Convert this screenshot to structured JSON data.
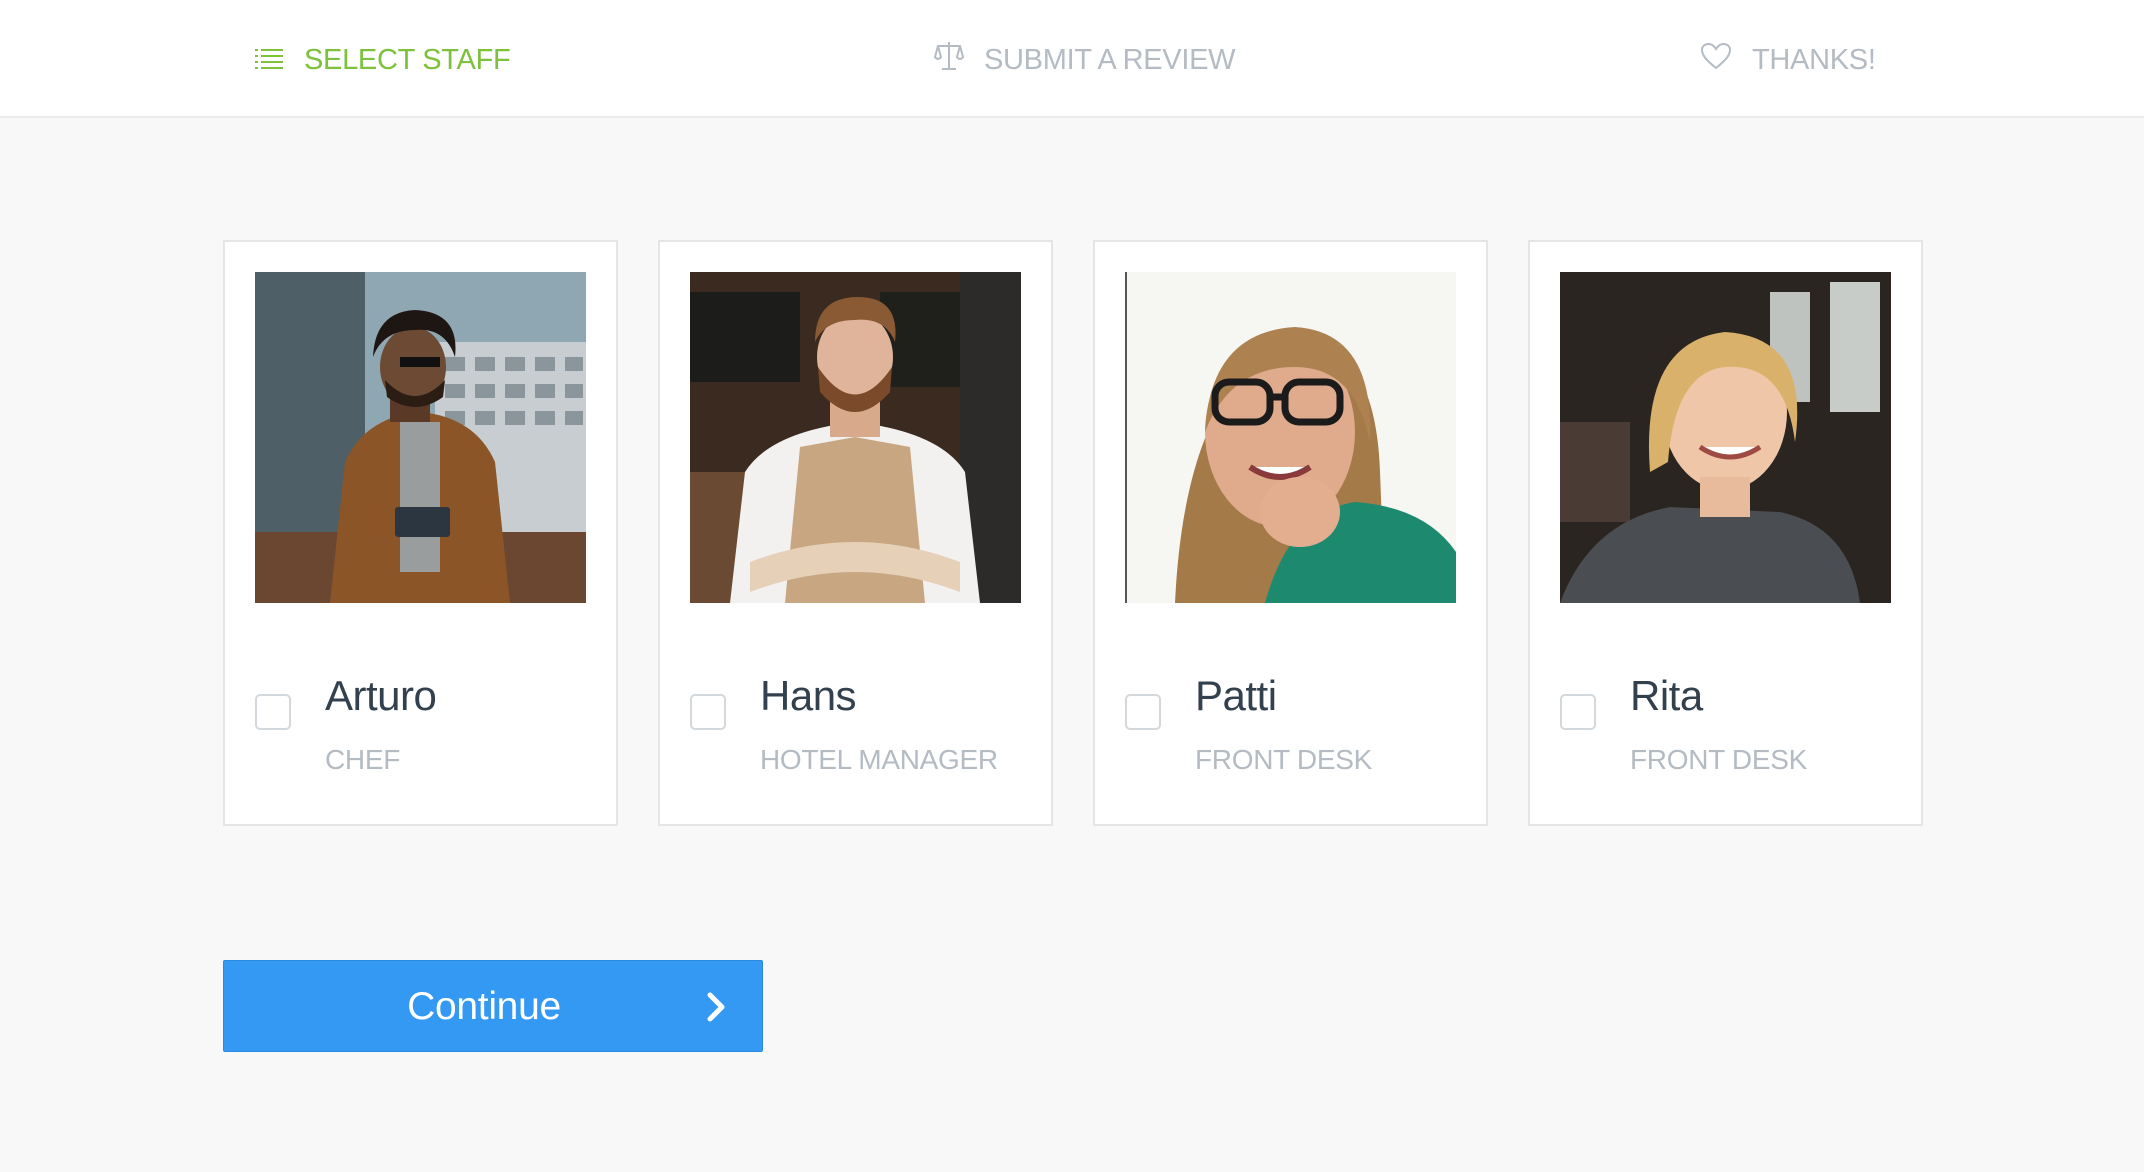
{
  "steps": [
    {
      "label": "SELECT STAFF",
      "icon": "list-icon",
      "active": true
    },
    {
      "label": "SUBMIT A REVIEW",
      "icon": "scales-icon",
      "active": false
    },
    {
      "label": "THANKS!",
      "icon": "heart-icon",
      "active": false
    }
  ],
  "staff": [
    {
      "name": "Arturo",
      "role": "CHEF",
      "checked": false
    },
    {
      "name": "Hans",
      "role": "HOTEL MANAGER",
      "checked": false
    },
    {
      "name": "Patti",
      "role": "FRONT DESK",
      "checked": false
    },
    {
      "name": "Rita",
      "role": "FRONT DESK",
      "checked": false
    }
  ],
  "continue_button": {
    "label": "Continue",
    "icon": "chevron-right-icon"
  },
  "colors": {
    "active_step": "#7dc13c",
    "inactive_step": "#b4bbc2",
    "primary_button": "#3399f3",
    "name_text": "#33404d"
  }
}
